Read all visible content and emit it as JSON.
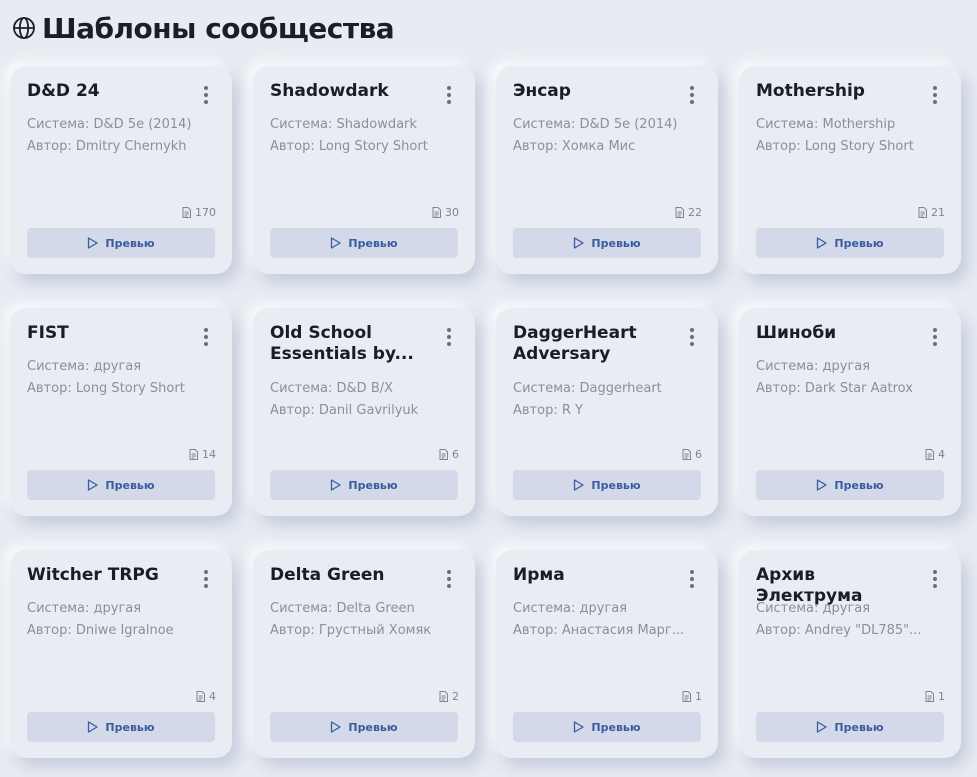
{
  "page": {
    "title": "Шаблоны сообщества",
    "icon": "globe-icon"
  },
  "labels": {
    "system_prefix": "Система: ",
    "author_prefix": "Автор: ",
    "preview": "Превью"
  },
  "colors": {
    "background": "#e8ebf2",
    "button_bg": "#d3d9e8",
    "accent": "#3a5ba0"
  },
  "cards": [
    {
      "title": "D&D 24",
      "system": "Система: D&D 5e (2014)",
      "author": "Автор: Dmitry Chernykh",
      "count": "170",
      "preview": "Превью"
    },
    {
      "title": "Shadowdark",
      "system": "Система: Shadowdark",
      "author": "Автор: Long Story Short",
      "count": "30",
      "preview": "Превью"
    },
    {
      "title": "Энсар",
      "system": "Система: D&D 5e (2014)",
      "author": "Автор: Хомка Мис",
      "count": "22",
      "preview": "Превью"
    },
    {
      "title": "Mothership",
      "system": "Система: Mothership",
      "author": "Автор: Long Story Short",
      "count": "21",
      "preview": "Превью"
    },
    {
      "title": "FIST",
      "system": "Система: другая",
      "author": "Автор: Long Story Short",
      "count": "14",
      "preview": "Превью"
    },
    {
      "title": "Old School Essentials by...",
      "system": "Система: D&D B/X",
      "author": "Автор: Danil Gavrilyuk",
      "count": "6",
      "preview": "Превью"
    },
    {
      "title": "DaggerHeart Adversary",
      "system": "Система: Daggerheart",
      "author": "Автор: R Y",
      "count": "6",
      "preview": "Превью"
    },
    {
      "title": "Шиноби",
      "system": "Система: другая",
      "author": "Автор: Dark Star Aatrox",
      "count": "4",
      "preview": "Превью"
    },
    {
      "title": "Witcher TRPG",
      "system": "Система: другая",
      "author": "Автор: Dniwe Igralnoe",
      "count": "4",
      "preview": "Превью"
    },
    {
      "title": "Delta Green",
      "system": "Система: Delta Green",
      "author": "Автор: Грустный Хомяк",
      "count": "2",
      "preview": "Превью"
    },
    {
      "title": "Ирма",
      "system": "Система: другая",
      "author": "Автор: Анастасия Марг...",
      "count": "1",
      "preview": "Превью"
    },
    {
      "title": "Архив Электрума",
      "system": "Система: другая",
      "author": "Автор: Andrey \"DL785\"...",
      "count": "1",
      "preview": "Превью"
    }
  ]
}
